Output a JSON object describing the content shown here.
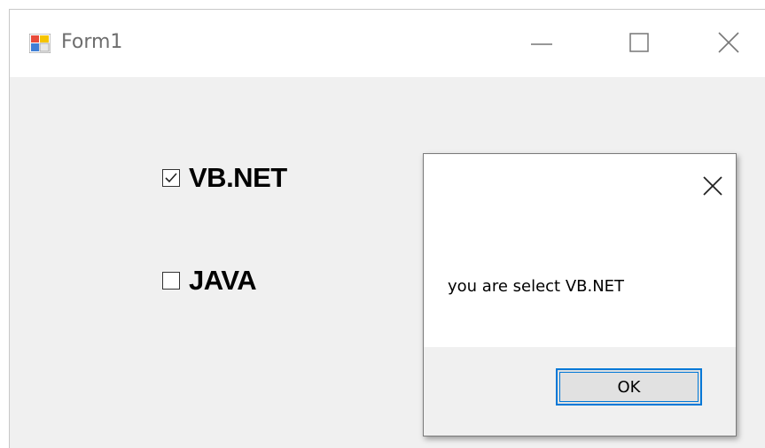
{
  "window": {
    "title": "Form1"
  },
  "checkboxes": [
    {
      "label": "VB.NET",
      "checked": true
    },
    {
      "label": "JAVA",
      "checked": false
    }
  ],
  "dialog": {
    "message": "you are select VB.NET",
    "ok_label": "OK"
  },
  "colors": {
    "accent": "#0078d7",
    "window_bg": "#f0f0f0",
    "title_text": "#6e6e6e"
  }
}
